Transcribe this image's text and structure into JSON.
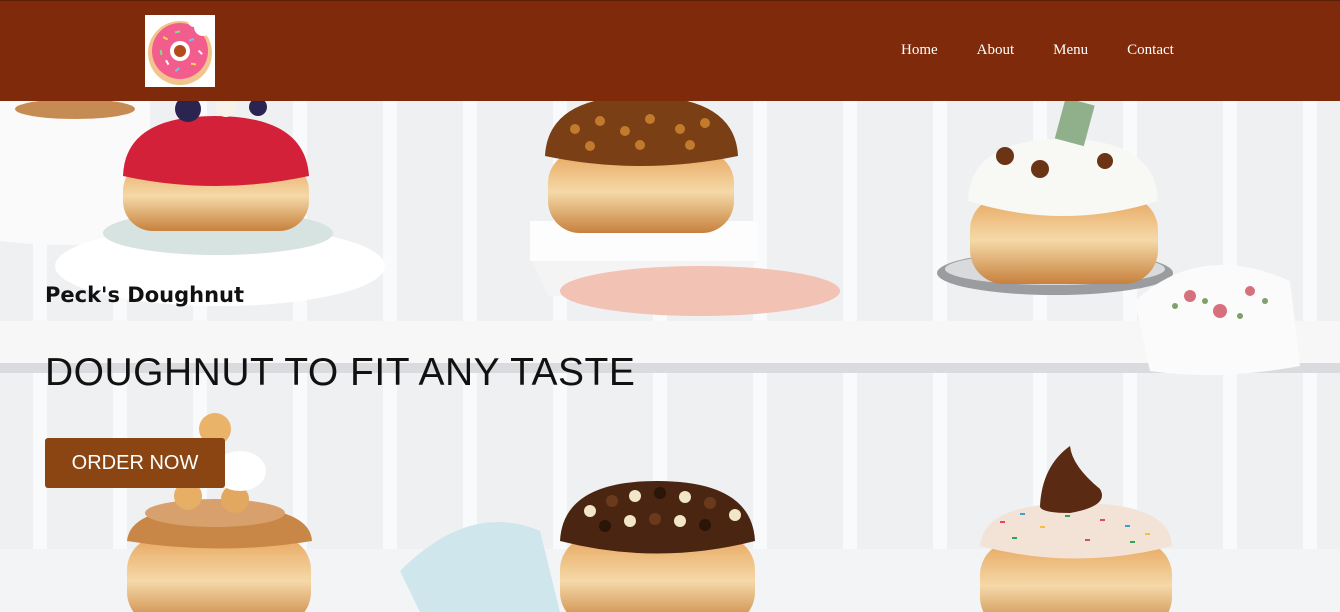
{
  "nav": {
    "logo_icon": "pink-doughnut-logo-icon",
    "items": [
      {
        "label": "Home"
      },
      {
        "label": "About"
      },
      {
        "label": "Menu"
      },
      {
        "label": "Contact"
      }
    ]
  },
  "hero": {
    "brand": "Peck's Doughnut",
    "headline": "DOUGHNUT TO FIT ANY TASTE",
    "cta_label": "ORDER NOW",
    "background": "doughnut-display-photo"
  },
  "colors": {
    "nav_bg": "#7f2a0a",
    "cta_bg": "#8b4513",
    "text": "#111111"
  }
}
